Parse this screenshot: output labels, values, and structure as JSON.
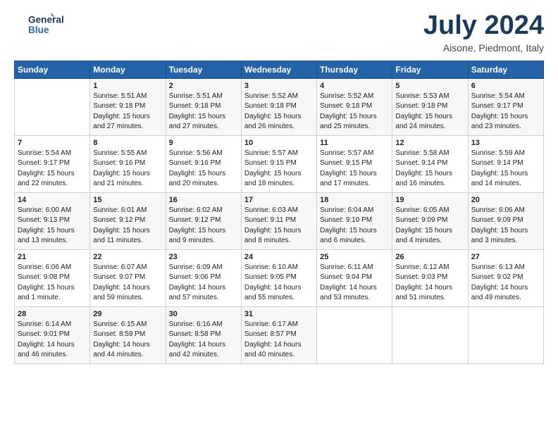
{
  "logo": {
    "line1": "General",
    "line2": "Blue"
  },
  "title": "July 2024",
  "subtitle": "Aisone, Piedmont, Italy",
  "days_header": [
    "Sunday",
    "Monday",
    "Tuesday",
    "Wednesday",
    "Thursday",
    "Friday",
    "Saturday"
  ],
  "weeks": [
    [
      {
        "day": "",
        "sunrise": "",
        "sunset": "",
        "daylight": ""
      },
      {
        "day": "1",
        "sunrise": "Sunrise: 5:51 AM",
        "sunset": "Sunset: 9:18 PM",
        "daylight": "Daylight: 15 hours and 27 minutes."
      },
      {
        "day": "2",
        "sunrise": "Sunrise: 5:51 AM",
        "sunset": "Sunset: 9:18 PM",
        "daylight": "Daylight: 15 hours and 27 minutes."
      },
      {
        "day": "3",
        "sunrise": "Sunrise: 5:52 AM",
        "sunset": "Sunset: 9:18 PM",
        "daylight": "Daylight: 15 hours and 26 minutes."
      },
      {
        "day": "4",
        "sunrise": "Sunrise: 5:52 AM",
        "sunset": "Sunset: 9:18 PM",
        "daylight": "Daylight: 15 hours and 25 minutes."
      },
      {
        "day": "5",
        "sunrise": "Sunrise: 5:53 AM",
        "sunset": "Sunset: 9:18 PM",
        "daylight": "Daylight: 15 hours and 24 minutes."
      },
      {
        "day": "6",
        "sunrise": "Sunrise: 5:54 AM",
        "sunset": "Sunset: 9:17 PM",
        "daylight": "Daylight: 15 hours and 23 minutes."
      }
    ],
    [
      {
        "day": "7",
        "sunrise": "Sunrise: 5:54 AM",
        "sunset": "Sunset: 9:17 PM",
        "daylight": "Daylight: 15 hours and 22 minutes."
      },
      {
        "day": "8",
        "sunrise": "Sunrise: 5:55 AM",
        "sunset": "Sunset: 9:16 PM",
        "daylight": "Daylight: 15 hours and 21 minutes."
      },
      {
        "day": "9",
        "sunrise": "Sunrise: 5:56 AM",
        "sunset": "Sunset: 9:16 PM",
        "daylight": "Daylight: 15 hours and 20 minutes."
      },
      {
        "day": "10",
        "sunrise": "Sunrise: 5:57 AM",
        "sunset": "Sunset: 9:15 PM",
        "daylight": "Daylight: 15 hours and 18 minutes."
      },
      {
        "day": "11",
        "sunrise": "Sunrise: 5:57 AM",
        "sunset": "Sunset: 9:15 PM",
        "daylight": "Daylight: 15 hours and 17 minutes."
      },
      {
        "day": "12",
        "sunrise": "Sunrise: 5:58 AM",
        "sunset": "Sunset: 9:14 PM",
        "daylight": "Daylight: 15 hours and 16 minutes."
      },
      {
        "day": "13",
        "sunrise": "Sunrise: 5:59 AM",
        "sunset": "Sunset: 9:14 PM",
        "daylight": "Daylight: 15 hours and 14 minutes."
      }
    ],
    [
      {
        "day": "14",
        "sunrise": "Sunrise: 6:00 AM",
        "sunset": "Sunset: 9:13 PM",
        "daylight": "Daylight: 15 hours and 13 minutes."
      },
      {
        "day": "15",
        "sunrise": "Sunrise: 6:01 AM",
        "sunset": "Sunset: 9:12 PM",
        "daylight": "Daylight: 15 hours and 11 minutes."
      },
      {
        "day": "16",
        "sunrise": "Sunrise: 6:02 AM",
        "sunset": "Sunset: 9:12 PM",
        "daylight": "Daylight: 15 hours and 9 minutes."
      },
      {
        "day": "17",
        "sunrise": "Sunrise: 6:03 AM",
        "sunset": "Sunset: 9:11 PM",
        "daylight": "Daylight: 15 hours and 8 minutes."
      },
      {
        "day": "18",
        "sunrise": "Sunrise: 6:04 AM",
        "sunset": "Sunset: 9:10 PM",
        "daylight": "Daylight: 15 hours and 6 minutes."
      },
      {
        "day": "19",
        "sunrise": "Sunrise: 6:05 AM",
        "sunset": "Sunset: 9:09 PM",
        "daylight": "Daylight: 15 hours and 4 minutes."
      },
      {
        "day": "20",
        "sunrise": "Sunrise: 6:06 AM",
        "sunset": "Sunset: 9:09 PM",
        "daylight": "Daylight: 15 hours and 3 minutes."
      }
    ],
    [
      {
        "day": "21",
        "sunrise": "Sunrise: 6:06 AM",
        "sunset": "Sunset: 9:08 PM",
        "daylight": "Daylight: 15 hours and 1 minute."
      },
      {
        "day": "22",
        "sunrise": "Sunrise: 6:07 AM",
        "sunset": "Sunset: 9:07 PM",
        "daylight": "Daylight: 14 hours and 59 minutes."
      },
      {
        "day": "23",
        "sunrise": "Sunrise: 6:09 AM",
        "sunset": "Sunset: 9:06 PM",
        "daylight": "Daylight: 14 hours and 57 minutes."
      },
      {
        "day": "24",
        "sunrise": "Sunrise: 6:10 AM",
        "sunset": "Sunset: 9:05 PM",
        "daylight": "Daylight: 14 hours and 55 minutes."
      },
      {
        "day": "25",
        "sunrise": "Sunrise: 6:11 AM",
        "sunset": "Sunset: 9:04 PM",
        "daylight": "Daylight: 14 hours and 53 minutes."
      },
      {
        "day": "26",
        "sunrise": "Sunrise: 6:12 AM",
        "sunset": "Sunset: 9:03 PM",
        "daylight": "Daylight: 14 hours and 51 minutes."
      },
      {
        "day": "27",
        "sunrise": "Sunrise: 6:13 AM",
        "sunset": "Sunset: 9:02 PM",
        "daylight": "Daylight: 14 hours and 49 minutes."
      }
    ],
    [
      {
        "day": "28",
        "sunrise": "Sunrise: 6:14 AM",
        "sunset": "Sunset: 9:01 PM",
        "daylight": "Daylight: 14 hours and 46 minutes."
      },
      {
        "day": "29",
        "sunrise": "Sunrise: 6:15 AM",
        "sunset": "Sunset: 8:59 PM",
        "daylight": "Daylight: 14 hours and 44 minutes."
      },
      {
        "day": "30",
        "sunrise": "Sunrise: 6:16 AM",
        "sunset": "Sunset: 8:58 PM",
        "daylight": "Daylight: 14 hours and 42 minutes."
      },
      {
        "day": "31",
        "sunrise": "Sunrise: 6:17 AM",
        "sunset": "Sunset: 8:57 PM",
        "daylight": "Daylight: 14 hours and 40 minutes."
      },
      {
        "day": "",
        "sunrise": "",
        "sunset": "",
        "daylight": ""
      },
      {
        "day": "",
        "sunrise": "",
        "sunset": "",
        "daylight": ""
      },
      {
        "day": "",
        "sunrise": "",
        "sunset": "",
        "daylight": ""
      }
    ]
  ]
}
